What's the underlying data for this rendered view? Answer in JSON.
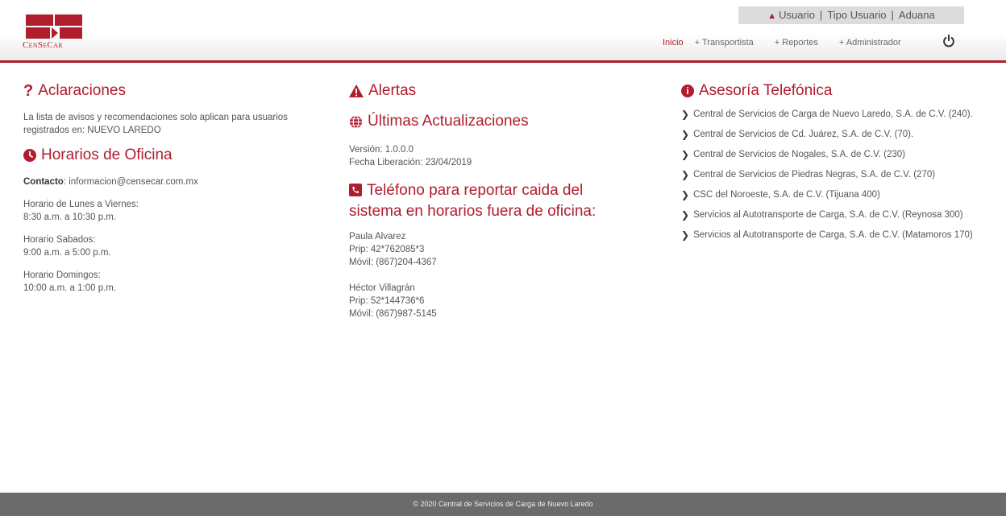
{
  "brand": {
    "name": "CenSeCar",
    "accent": "#b01d2d"
  },
  "userbar": {
    "user": "Usuario",
    "role": "Tipo Usuario",
    "area": "Aduana"
  },
  "nav": {
    "inicio": "Inicio",
    "transportista": "+ Transportista",
    "reportes": "+ Reportes",
    "administrador": "+ Administrador"
  },
  "aclaraciones": {
    "title": "Aclaraciones",
    "text": "La lista de avisos y recomendaciones solo aplican para usuarios registrados en: NUEVO LAREDO"
  },
  "horarios": {
    "title": "Horarios de Oficina",
    "contact_label": "Contacto",
    "contact_value": ": informacion@censecar.com.mx",
    "weekday_label": "Horario de Lunes a Viernes:",
    "weekday_hours": "8:30 a.m. a 10:30 p.m.",
    "saturday_label": "Horario Sabados:",
    "saturday_hours": "9:00 a.m. a 5:00 p.m.",
    "sunday_label": "Horario Domingos:",
    "sunday_hours": "10:00 a.m. a 1:00 p.m."
  },
  "alertas": {
    "title": "Alertas"
  },
  "actualizaciones": {
    "title": "Últimas Actualizaciones",
    "version": "Versión: 1.0.0.0",
    "release": "Fecha Liberación: 23/04/2019"
  },
  "telefono": {
    "title_line1": "Teléfono para reportar caida del",
    "title_line2": "sistema en horarios fuera de oficina:",
    "contacts": [
      {
        "name": "Paula Alvarez",
        "prip": "Prip: 42*762085*3",
        "movil": "Móvil: (867)204-4367"
      },
      {
        "name": "Héctor Villagrán",
        "prip": "Prip: 52*144736*6",
        "movil": "Móvil: (867)987-5145"
      }
    ]
  },
  "asesoria": {
    "title": "Asesoría Telefónica",
    "items": [
      "Central de Servicios de Carga de Nuevo Laredo, S.A. de C.V. (240).",
      "Central de Servicios de Cd. Juárez, S.A. de C.V. (70).",
      "Central de Servicios de Nogales, S.A. de C.V. (230)",
      "Central de Servicios de Piedras Negras, S.A. de C.V. (270)",
      "CSC del Noroeste, S.A. de C.V. (Tijuana 400)",
      "Servicios al Autotransporte de Carga, S.A. de C.V. (Reynosa 300)",
      "Servicios al Autotransporte de Carga, S.A. de C.V. (Matamoros 170)"
    ]
  },
  "footer": {
    "text": "© 2020 Central de Servicios de Carga de Nuevo Laredo"
  }
}
